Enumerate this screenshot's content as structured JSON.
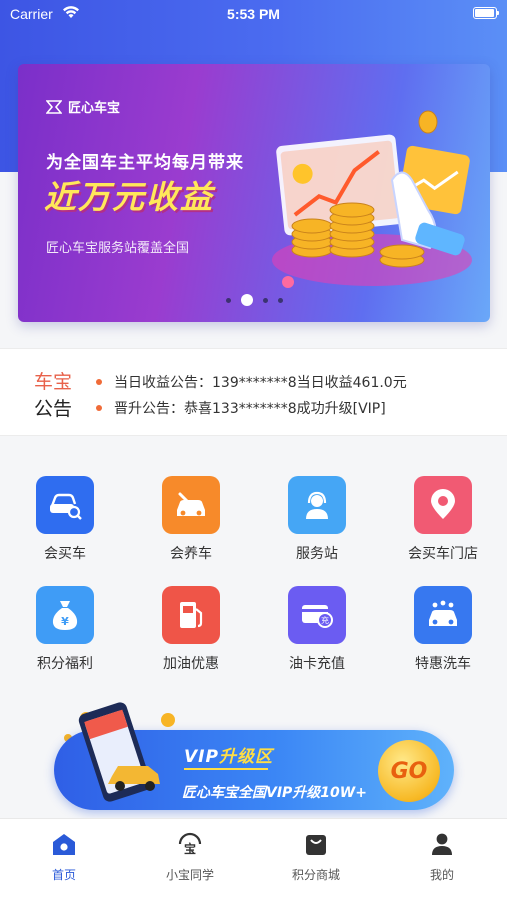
{
  "status_bar": {
    "carrier": "Carrier",
    "time": "5:53 PM",
    "battery_level": 0.95
  },
  "banner": {
    "brand": "匠心车宝",
    "headline": "为全国车主平均每月带来",
    "highlight": "近万元收益",
    "subline": "匠心车宝服务站覆盖全国",
    "page_count": 4,
    "active_page": 1
  },
  "notice": {
    "title_top": "车宝",
    "title_bottom": "公告",
    "items": [
      "当日收益公告：139*******8当日收益461.0元",
      "晋升公告：恭喜133*******8成功升级[VIP]"
    ]
  },
  "services": [
    {
      "label": "会买车",
      "icon": "car-search-icon",
      "color": "#2f6df0"
    },
    {
      "label": "会养车",
      "icon": "car-repair-icon",
      "color": "#f78a2a"
    },
    {
      "label": "服务站",
      "icon": "service-agent-icon",
      "color": "#45a6f5"
    },
    {
      "label": "会买车门店",
      "icon": "location-pin-icon",
      "color": "#f15a73"
    },
    {
      "label": "积分福利",
      "icon": "money-bag-icon",
      "color": "#3f9cf6"
    },
    {
      "label": "加油优惠",
      "icon": "fuel-pump-icon",
      "color": "#ef5548"
    },
    {
      "label": "油卡充值",
      "icon": "card-recharge-icon",
      "color": "#6b5cf2"
    },
    {
      "label": "特惠洗车",
      "icon": "car-wash-icon",
      "color": "#3778f0"
    }
  ],
  "vip_banner": {
    "title_prefix": "VIP",
    "title_suffix": "升级区",
    "subtitle": "匠心车宝全国VIP升级10W+",
    "go_label": "GO"
  },
  "tabs": [
    {
      "label": "首页",
      "icon": "home-icon",
      "active": true
    },
    {
      "label": "小宝同学",
      "icon": "assistant-icon",
      "active": false
    },
    {
      "label": "积分商城",
      "icon": "shopping-bag-icon",
      "active": false
    },
    {
      "label": "我的",
      "icon": "profile-icon",
      "active": false
    }
  ]
}
